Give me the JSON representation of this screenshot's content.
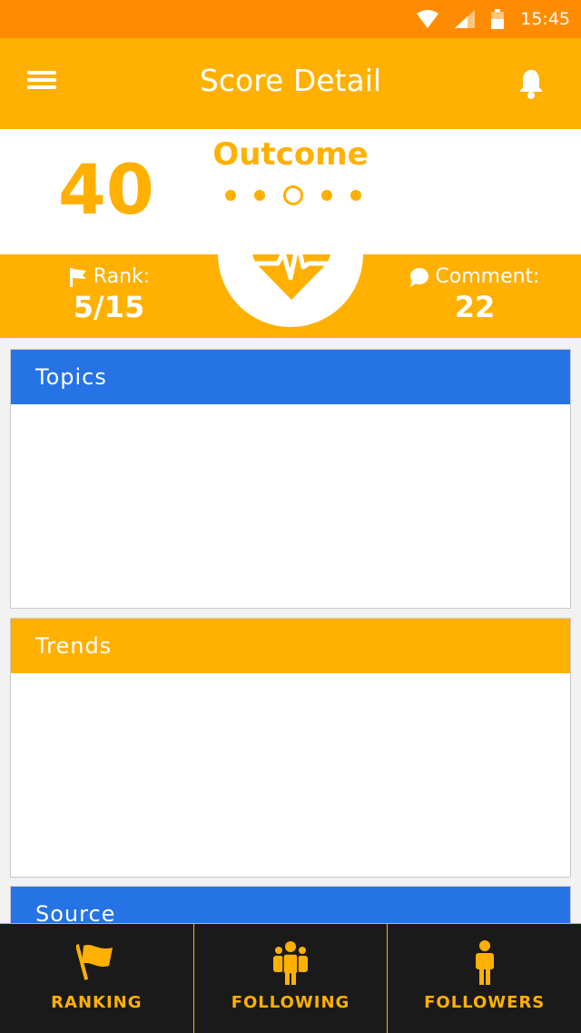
{
  "status_bar": {
    "time": "15:45"
  },
  "app_bar": {
    "title": "Score Detail"
  },
  "score": {
    "value": "40",
    "outcome_label": "Outcome",
    "pager_total": 5,
    "pager_active_index": 2
  },
  "stats": {
    "rank_label": "Rank:",
    "rank_value": "5/15",
    "comment_label": "Comment:",
    "comment_value": "22"
  },
  "cards": {
    "topics": {
      "title": "Topics"
    },
    "trends": {
      "title": "Trends"
    },
    "source": {
      "title": "Source"
    }
  },
  "bottom_nav": {
    "ranking": "RANKING",
    "following": "FOLLOWING",
    "followers": "FOLLOWERS"
  },
  "colors": {
    "accent": "#ffb000",
    "status_bar": "#ff8c00",
    "blue": "#2673e6",
    "nav_bg": "#1a1a1a"
  },
  "icons": [
    "wifi-icon",
    "signal-icon",
    "battery-icon",
    "menu-icon",
    "bell-icon",
    "heart-pulse-icon",
    "flag-icon",
    "comment-icon",
    "group-icon",
    "person-icon"
  ]
}
